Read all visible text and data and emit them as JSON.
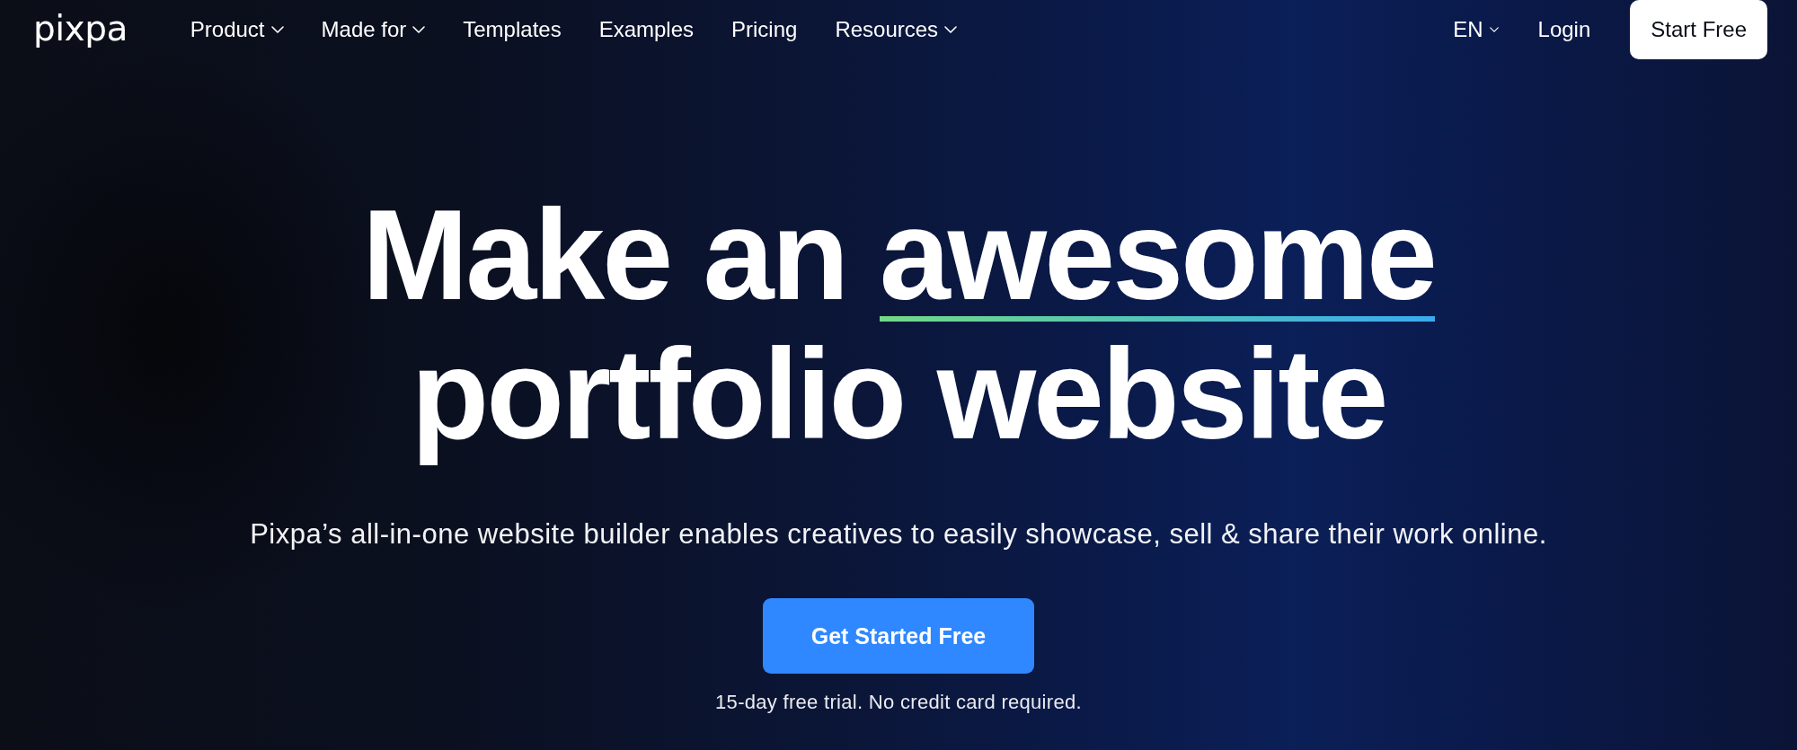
{
  "nav": {
    "logo": "pixpa",
    "items": [
      {
        "label": "Product",
        "dropdown": true
      },
      {
        "label": "Made for",
        "dropdown": true
      },
      {
        "label": "Templates",
        "dropdown": false
      },
      {
        "label": "Examples",
        "dropdown": false
      },
      {
        "label": "Pricing",
        "dropdown": false
      },
      {
        "label": "Resources",
        "dropdown": true
      }
    ],
    "language": {
      "label": "EN",
      "dropdown": true
    },
    "login": "Login",
    "cta": "Start Free"
  },
  "hero": {
    "headline": {
      "lines": [
        [
          {
            "text": "Make an",
            "underlined": false
          },
          {
            "text": "awesome",
            "underlined": true
          }
        ],
        [
          {
            "text": "portfolio website",
            "underlined": false
          }
        ]
      ]
    },
    "subtitle": "Pixpa’s all-in-one website builder enables creatives to easily showcase, sell & share their work online.",
    "button": "Get Started Free",
    "note": "15-day free trial. No credit card required."
  }
}
